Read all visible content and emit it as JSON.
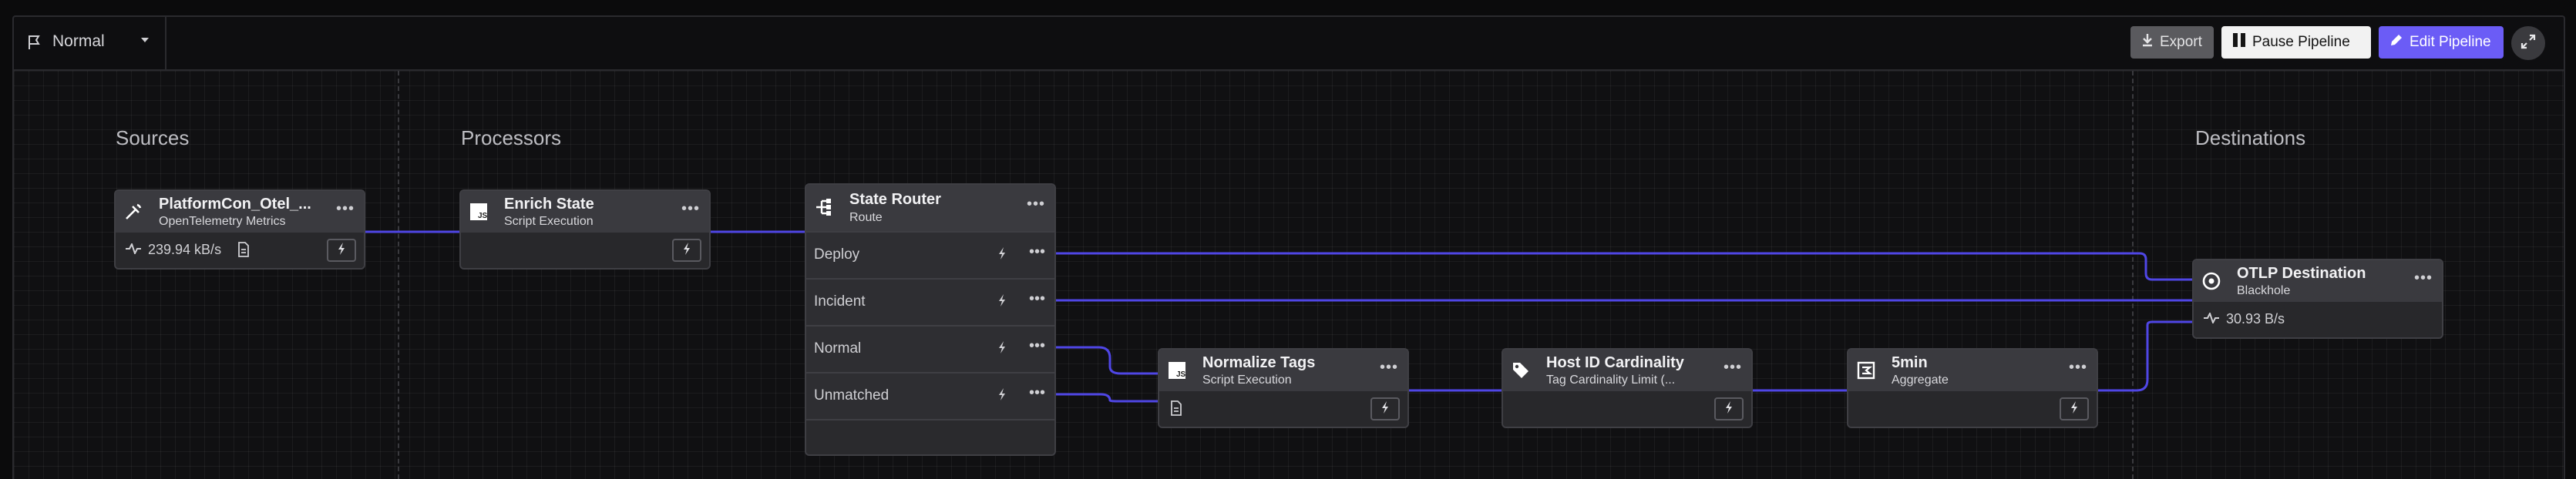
{
  "toolbar": {
    "mode": "Normal",
    "export_label": "Export",
    "pause_label": "Pause Pipeline",
    "edit_label": "Edit Pipeline"
  },
  "sections": {
    "sources": "Sources",
    "processors": "Processors",
    "destinations": "Destinations"
  },
  "nodes": {
    "source": {
      "title": "PlatformCon_Otel_...",
      "subtitle": "OpenTelemetry Metrics",
      "metric": "239.94 kB/s",
      "icon": "antenna-icon"
    },
    "enrich": {
      "title": "Enrich State",
      "subtitle": "Script Execution",
      "icon": "js-icon"
    },
    "router": {
      "title": "State Router",
      "subtitle": "Route",
      "icon": "route-icon",
      "routes": [
        "Deploy",
        "Incident",
        "Normal",
        "Unmatched"
      ]
    },
    "normalize": {
      "title": "Normalize Tags",
      "subtitle": "Script Execution",
      "icon": "js-icon"
    },
    "cardinality": {
      "title": "Host ID Cardinality",
      "subtitle": "Tag Cardinality Limit (...",
      "icon": "tag-icon"
    },
    "aggregate": {
      "title": "5min",
      "subtitle": "Aggregate",
      "icon": "aggregate-icon"
    },
    "destination": {
      "title": "OTLP Destination",
      "subtitle": "Blackhole",
      "metric": "30.93 B/s",
      "icon": "target-icon"
    }
  },
  "colors": {
    "accent": "#6b5cf6",
    "wire": "#4f46e5",
    "node_bg": "#2e2e32",
    "node_head": "#3a3a3f"
  }
}
